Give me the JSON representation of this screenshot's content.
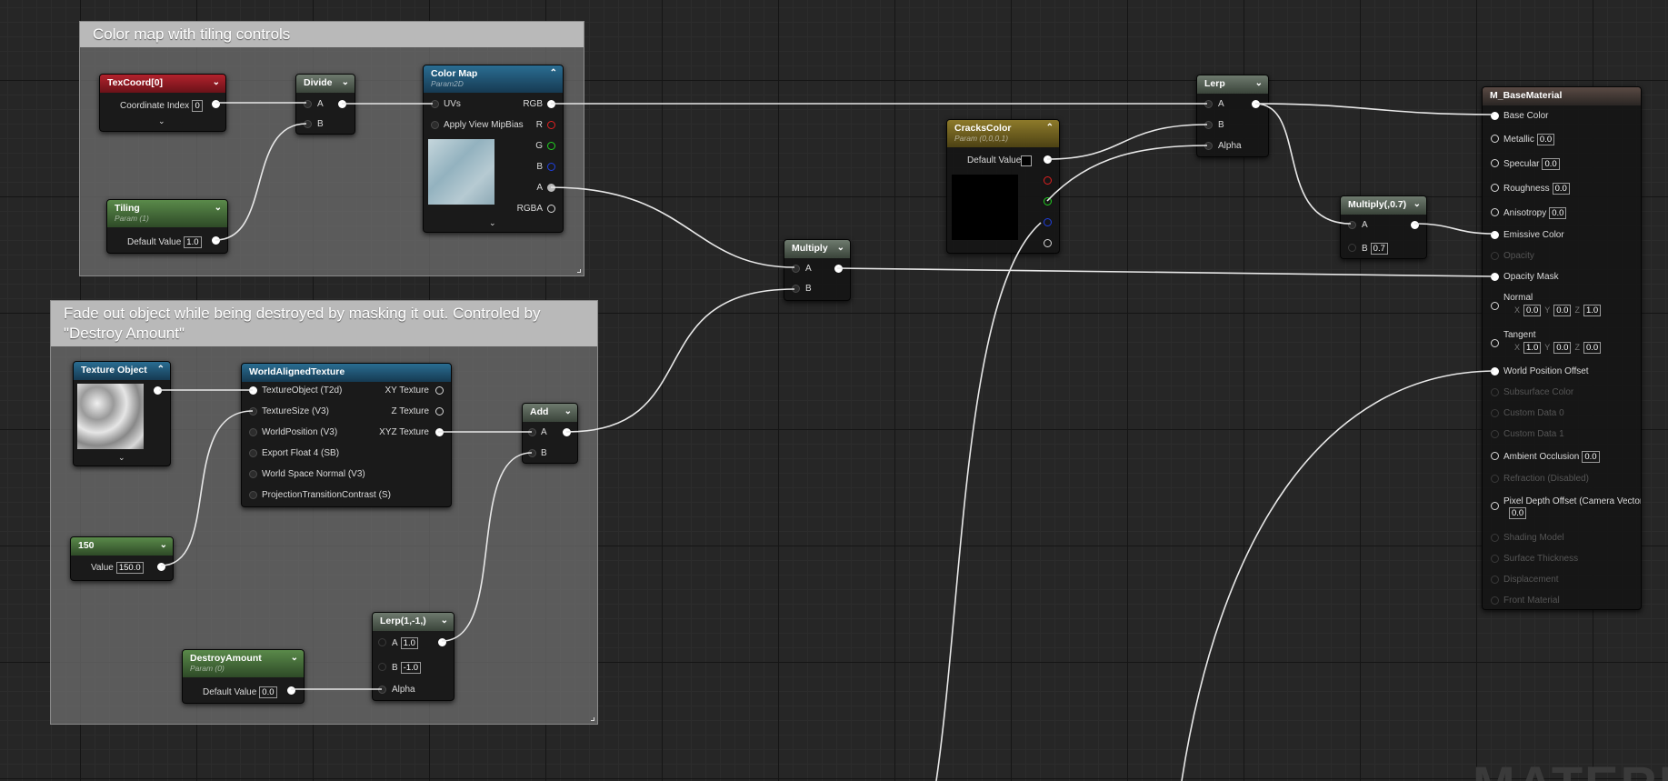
{
  "comments": {
    "color_map": "Color map with tiling controls",
    "fade_out": "Fade out object while being destroyed by masking it out.  Controled by \"Destroy Amount\""
  },
  "texcoord": {
    "title": "TexCoord[0]",
    "label": "Coordinate Index",
    "value": "0"
  },
  "divide": {
    "title": "Divide",
    "a": "A",
    "b": "B"
  },
  "tiling": {
    "title": "Tiling",
    "sub": "Param (1)",
    "label": "Default Value",
    "value": "1.0"
  },
  "color_map": {
    "title": "Color Map",
    "sub": "Param2D",
    "uvs": "UVs",
    "mipbias": "Apply View MipBias",
    "rgb": "RGB",
    "r": "R",
    "g": "G",
    "b": "B",
    "a": "A",
    "rgba": "RGBA"
  },
  "multiply": {
    "title": "Multiply",
    "a": "A",
    "b": "B"
  },
  "cracks": {
    "title": "CracksColor",
    "sub": "Param (0,0,0,1)",
    "label": "Default Value"
  },
  "lerp": {
    "title": "Lerp",
    "a": "A",
    "b": "B",
    "alpha": "Alpha"
  },
  "multiply07": {
    "title": "Multiply(,0.7)",
    "a": "A",
    "b": "B",
    "b_value": "0.7"
  },
  "texture_object": {
    "title": "Texture Object"
  },
  "world_aligned": {
    "title": "WorldAlignedTexture",
    "inputs": [
      "TextureObject (T2d)",
      "TextureSize (V3)",
      "WorldPosition (V3)",
      "Export Float 4 (SB)",
      "World Space Normal (V3)",
      "ProjectionTransitionContrast (S)"
    ],
    "outputs": [
      "XY Texture",
      "Z Texture",
      "XYZ Texture"
    ]
  },
  "add": {
    "title": "Add",
    "a": "A",
    "b": "B"
  },
  "const150": {
    "title": "150",
    "label": "Value",
    "value": "150.0"
  },
  "lerp2": {
    "title": "Lerp(1,-1,)",
    "a": "A",
    "a_value": "1.0",
    "b": "B",
    "b_value": "-1.0",
    "alpha": "Alpha"
  },
  "destroy": {
    "title": "DestroyAmount",
    "sub": "Param (0)",
    "label": "Default Value",
    "value": "0.0"
  },
  "base_material": {
    "title": "M_BaseMaterial",
    "base_color": "Base Color",
    "metallic": "Metallic",
    "metallic_value": "0.0",
    "specular": "Specular",
    "specular_value": "0.0",
    "roughness": "Roughness",
    "roughness_value": "0.0",
    "anisotropy": "Anisotropy",
    "anisotropy_value": "0.0",
    "emissive": "Emissive Color",
    "opacity": "Opacity",
    "opacity_mask": "Opacity Mask",
    "normal": "Normal",
    "normal_x": "0.0",
    "normal_y": "0.0",
    "normal_z": "1.0",
    "tangent": "Tangent",
    "tangent_x": "1.0",
    "tangent_y": "0.0",
    "tangent_z": "0.0",
    "wpo": "World Position Offset",
    "subsurface": "Subsurface Color",
    "custom0": "Custom Data 0",
    "custom1": "Custom Data 1",
    "ao": "Ambient Occlusion",
    "ao_value": "0.0",
    "refraction": "Refraction (Disabled)",
    "pdo": "Pixel Depth Offset (Camera Vector)",
    "pdo_value": "0.0",
    "shading_model": "Shading Model",
    "surface_thickness": "Surface Thickness",
    "displacement": "Displacement",
    "front_material": "Front Material",
    "x": "X",
    "y": "Y",
    "z": "Z"
  },
  "watermark": "MATERI"
}
